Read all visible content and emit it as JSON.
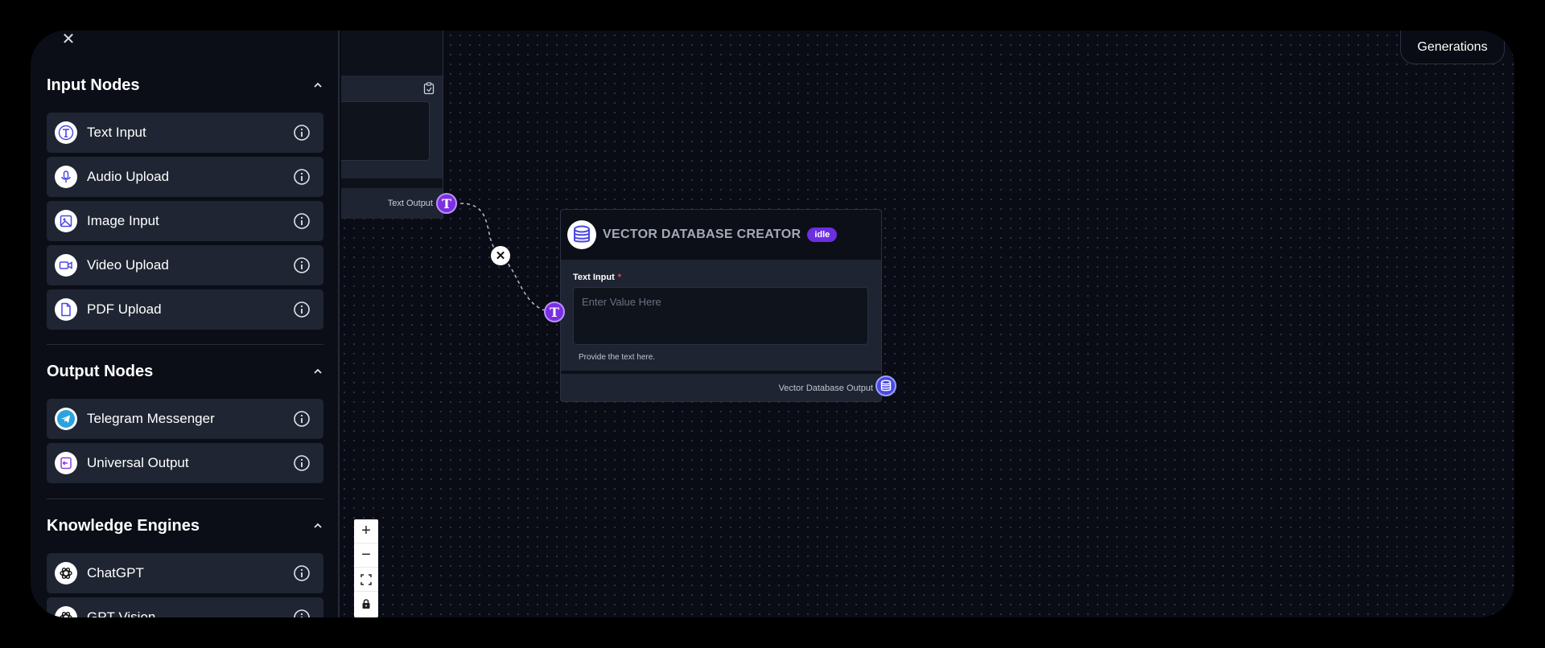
{
  "sidebar": {
    "sections": [
      {
        "title": "Input Nodes",
        "items": [
          {
            "label": "Text Input",
            "icon": "text-t-icon"
          },
          {
            "label": "Audio Upload",
            "icon": "microphone-icon"
          },
          {
            "label": "Image Input",
            "icon": "image-icon"
          },
          {
            "label": "Video Upload",
            "icon": "video-camera-icon"
          },
          {
            "label": "PDF Upload",
            "icon": "document-icon"
          }
        ]
      },
      {
        "title": "Output Nodes",
        "items": [
          {
            "label": "Telegram Messenger",
            "icon": "telegram-icon"
          },
          {
            "label": "Universal Output",
            "icon": "export-icon"
          }
        ]
      },
      {
        "title": "Knowledge Engines",
        "items": [
          {
            "label": "ChatGPT",
            "icon": "openai-icon"
          },
          {
            "label": "GPT Vision",
            "icon": "openai-icon"
          }
        ]
      }
    ]
  },
  "left_node": {
    "output_label": "Text Output"
  },
  "vector_node": {
    "title": "VECTOR DATABASE CREATOR",
    "status": "idle",
    "field_label": "Text Input",
    "required_mark": "*",
    "placeholder": "Enter Value Here",
    "help_text": "Provide the text here.",
    "output_label": "Vector Database Output"
  },
  "port_glyph": "T",
  "generations_label": "Generations",
  "colors": {
    "accent_purple": "#7b2fe0",
    "db_port": "#4a48e0",
    "canvas_bg": "#090c14",
    "item_bg": "#1f2532"
  }
}
